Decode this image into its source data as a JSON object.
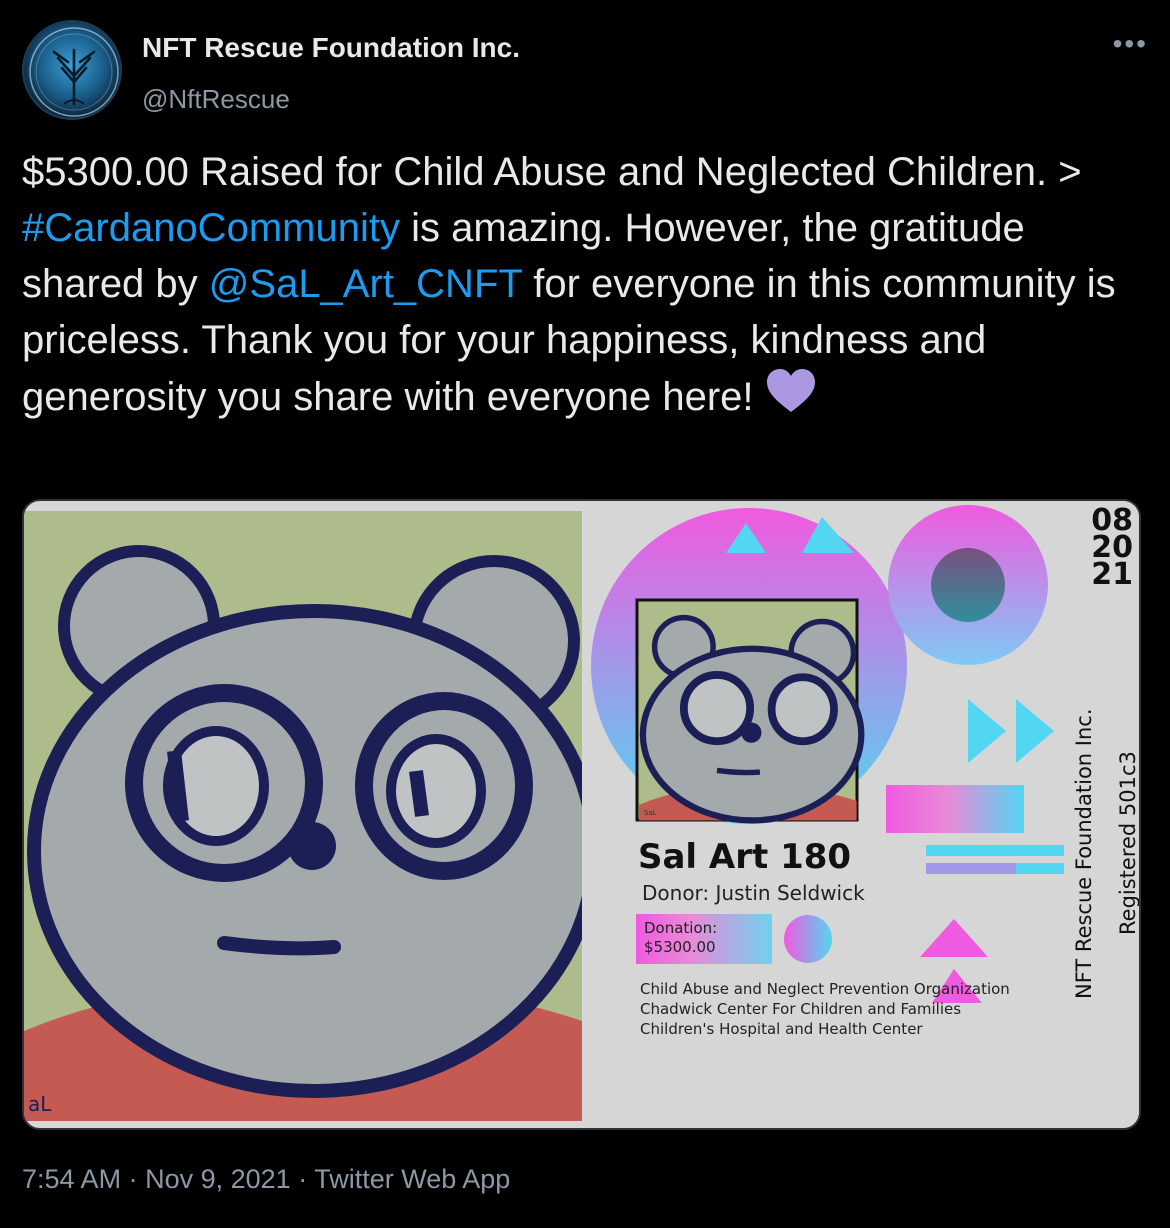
{
  "author": {
    "name": "NFT Rescue Foundation Inc.",
    "handle": "@NftRescue",
    "avatar_icon": "tree-logo-icon",
    "more_icon": "more-options-icon",
    "more_label": "•••"
  },
  "tweet": {
    "line1": "$5300.00 Raised for Child Abuse and Neglected Children. > ",
    "hashtag": "#CardanoCommunity",
    "line2": "  is amazing. However, the gratitude shared by ",
    "mention": "@SaL_Art_CNFT",
    "line3": " for everyone in this community is priceless.  Thank you for your happiness, kindness and generosity you share with everyone here! ",
    "heart_icon": "purple-heart-icon",
    "heart_color": "#ac97e2",
    "link_color": "#1d9bf0"
  },
  "media": {
    "left_image": "panda-drawing",
    "signature": "aL",
    "small_signature": "SaL",
    "certificate": {
      "date_lines": [
        "08",
        "20",
        "21"
      ],
      "title": "Sal Art 180",
      "donor": "Donor: Justin Seldwick",
      "donation_label": "Donation:",
      "donation_amount": "$5300.00",
      "orgs": [
        "Child Abuse and Neglect Prevention Organization",
        "Chadwick Center For Children and Families",
        "Children's Hospital and Health Center"
      ],
      "vertical_org": "NFT Rescue Foundation Inc.",
      "vertical_reg": "Registered 501c3",
      "accent_pink": "#f05ae0",
      "accent_cyan": "#52d6f2"
    }
  },
  "footer": {
    "time": "7:54 AM",
    "date": "Nov 9, 2021",
    "app": "Twitter Web App"
  }
}
